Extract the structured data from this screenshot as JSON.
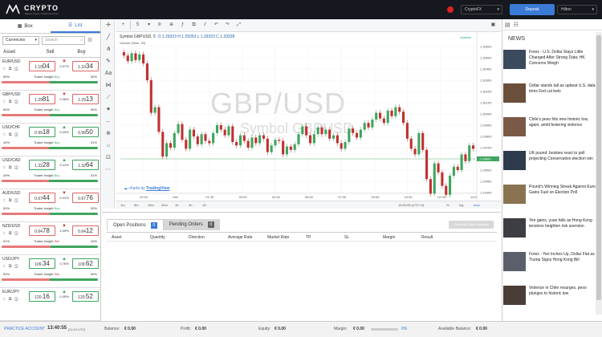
{
  "brand": {
    "name": "CRYPTO",
    "tagline": "Bitcoin Crypto Trading Services"
  },
  "topbar": {
    "account_selector": "CryptoFX",
    "deposit_label": "Deposit",
    "user_name": "Hilton"
  },
  "left_panel": {
    "tabs": [
      {
        "label": "Box"
      },
      {
        "label": "List"
      }
    ],
    "filter_value": "Currencies",
    "search_placeholder": "Search",
    "headers": {
      "asset": "Asset",
      "sell": "Sell",
      "buy": "Buy"
    },
    "insight_label": "Trader insight",
    "pairs": [
      {
        "name": "EUR/USD",
        "sell_pre": "1.10",
        "sell_big": "04",
        "buy_pre": "1.10",
        "buy_big": "34",
        "change": "0.37%",
        "dir": "dn",
        "box": "r",
        "left_pct": "50%",
        "right_pct": "50%",
        "insight": "Buy",
        "fill": 50
      },
      {
        "name": "GBP/USD",
        "sell_pre": "1.29",
        "sell_big": "81",
        "buy_pre": "1.29",
        "buy_big": "13",
        "change": "0.36%",
        "dir": "dn",
        "box": "r",
        "left_pct": "50%",
        "right_pct": "50%",
        "insight": "Buy",
        "fill": 50
      },
      {
        "name": "USD/CHF",
        "sell_pre": "0.99",
        "sell_big": "18",
        "buy_pre": "0.99",
        "buy_big": "50",
        "change": "0.43%",
        "dir": "up",
        "box": "g",
        "left_pct": "49%",
        "right_pct": "51%",
        "insight": "Buy",
        "fill": 49
      },
      {
        "name": "USD/CAD",
        "sell_pre": "1.32",
        "sell_big": "28",
        "buy_pre": "1.32",
        "buy_big": "64",
        "change": "0.14%",
        "dir": "up",
        "box": "g",
        "left_pct": "49%",
        "right_pct": "51%",
        "insight": "Buy",
        "fill": 49
      },
      {
        "name": "AUD/USD",
        "sell_pre": "0.67",
        "sell_big": "44",
        "buy_pre": "0.67",
        "buy_big": "76",
        "change": "0.41%",
        "dir": "dn",
        "box": "r",
        "left_pct": "50%",
        "right_pct": "50%",
        "insight": "Buy",
        "fill": 50
      },
      {
        "name": "NZD/USD",
        "sell_pre": "0.64",
        "sell_big": "78",
        "buy_pre": "0.64",
        "buy_big": "12",
        "change": "1.09%",
        "dir": "dn",
        "box": "r",
        "left_pct": "51%",
        "right_pct": "49%",
        "insight": "Sell",
        "fill": 51
      },
      {
        "name": "USD/JPY",
        "sell_pre": "109.",
        "sell_big": "34",
        "buy_pre": "109.",
        "buy_big": "62",
        "change": "0.76%",
        "dir": "up",
        "box": "g",
        "left_pct": "50%",
        "right_pct": "50%",
        "insight": "Sell",
        "fill": 50
      },
      {
        "name": "EUR/JPY",
        "sell_pre": "120.",
        "sell_big": "16",
        "buy_pre": "120.",
        "buy_big": "52",
        "change": "0.40%",
        "dir": "up",
        "box": "g",
        "left_pct": "",
        "right_pct": "",
        "insight": "",
        "fill": 50
      }
    ]
  },
  "tv_toolbar": {
    "interval": "5",
    "realtime": "realtime"
  },
  "chart": {
    "symbol_line": "Symbol GBPUSD, 5",
    "ohlc": "O 1.29323 H 1.29353 L 1.29323 C 1.29328",
    "volume_line": "Volume (Nitro, 20)",
    "watermark": "GBP/USD",
    "watermark_sub": "Symbol GBPUSD",
    "tv_credit": "charts by",
    "tv_name": "TradingView",
    "current_price": "1.29600",
    "price_ticks": [
      "1.30600",
      "1.30500",
      "1.30400",
      "1.30300",
      "1.30200",
      "1.30100",
      "1.30000",
      "1.29900",
      "1.29800",
      "1.29700",
      "1.29600",
      "1.29500",
      "1.29400",
      "1.29300"
    ],
    "time_ticks": [
      "22:00",
      "Dec",
      "01:30",
      "03:00",
      "04:30",
      "06:00",
      "07:30",
      "09:00",
      "10:30",
      "12:00",
      "14:0"
    ],
    "timeframes": [
      "1m",
      "5m",
      "15m",
      "30m",
      "1h",
      "4h",
      "1D"
    ],
    "clock": "13:40:55 (UTC+2)",
    "scale_opts": [
      "%",
      "log",
      "auto"
    ]
  },
  "chart_data": {
    "type": "candlestick",
    "symbol": "GBPUSD",
    "interval": "5",
    "last": {
      "open": 1.29323,
      "high": 1.29353,
      "low": 1.29323,
      "close": 1.29328
    },
    "price_range": [
      1.293,
      1.306
    ],
    "closes": [
      1.3052,
      1.3047,
      1.3054,
      1.3048,
      1.3053,
      1.3045,
      1.303,
      1.3001,
      1.3006,
      1.2984,
      1.2962,
      1.2974,
      1.297,
      1.2983,
      1.2991,
      1.2977,
      1.2969,
      1.2986,
      1.298,
      1.2973,
      1.2982,
      1.2976,
      1.2974,
      1.2983,
      1.299,
      1.2986,
      1.2981,
      1.2989,
      1.2975,
      1.2972,
      1.2981,
      1.2976,
      1.297,
      1.2979,
      1.2974,
      1.2981,
      1.2978,
      1.2966,
      1.2972,
      1.2977,
      1.2976,
      1.2964,
      1.2971,
      1.2968,
      1.2973,
      1.2982,
      1.2989,
      1.2981,
      1.2974,
      1.2982,
      1.2988,
      1.2982,
      1.2986,
      1.2978,
      1.2981,
      1.2974,
      1.2969,
      1.2975,
      1.2987,
      1.2983,
      1.2979,
      1.2986,
      1.2992,
      1.2988,
      1.2995,
      1.3001,
      1.2996,
      1.2992,
      1.3003,
      1.2998,
      1.3006,
      1.3002,
      1.2992,
      1.2978,
      1.2969,
      1.2964,
      1.2983,
      1.2968,
      1.2942,
      1.2929,
      1.2956,
      1.2948,
      1.2936,
      1.2928,
      1.2945,
      1.2953,
      1.295,
      1.2964,
      1.2958,
      1.2972,
      1.2969
    ],
    "grid": true
  },
  "orders": {
    "tabs": [
      {
        "label": "Open Positions",
        "count": "0"
      },
      {
        "label": "Pending Orders",
        "count": "0"
      }
    ],
    "close_all": "Close all Open Positions",
    "columns": [
      "Asset",
      "Quantity",
      "Direction",
      "Average Rate",
      "Market Rate",
      "TP",
      "SL",
      "Margin",
      "Result"
    ]
  },
  "news": {
    "heading": "NEWS",
    "items": [
      {
        "title": "Forex - U.S. Dollar Stays Little Changed After Strong Data; HK Concerns Weigh",
        "color": "#3b4a5c"
      },
      {
        "title": "Dollar stands tall as upbeat U.S. data trims Fed cut bets",
        "color": "#6b4f3a"
      },
      {
        "title": "Chile's peso hits new historic low, again, amid festering violence",
        "color": "#7a5a46"
      },
      {
        "title": "UK pound, bookies react to poll projecting Conservative election win",
        "color": "#2e3a4d"
      },
      {
        "title": "Pound's Winning Streak Against Euro Gains Fuel on Election Poll",
        "color": "#8a7350"
      },
      {
        "title": "Yen gains, yuan falls as Hong Kong tensions heighten risk aversion",
        "color": "#3d3d44"
      },
      {
        "title": "Forex - Yen Inches Up, Dollar Flat as Trump Signs Hong Kong Bill",
        "color": "#5a5f6b"
      },
      {
        "title": "Violence in Chile resurges, peso plunges to historic low",
        "color": "#4a3c36"
      }
    ]
  },
  "footer": {
    "account_type": "PRACTICE ACCOUNT",
    "time": "13:40:55",
    "timezone": "[11:40 UTC]",
    "balance_label": "Balance:",
    "balance": "€ 0.00",
    "profit_label": "Profit:",
    "profit": "€ 0.00",
    "equity_label": "Equity:",
    "equity": "€ 0.00",
    "margin_label": "Margin:",
    "margin": "€ 0.00",
    "margin_pct": "0%",
    "available_label": "Available Balance:",
    "available": "€ 0.00"
  },
  "colors": {
    "accent": "#3a7bd5",
    "up": "#3ea55e",
    "down": "#d23a3a",
    "header_bg": "#15191f"
  }
}
